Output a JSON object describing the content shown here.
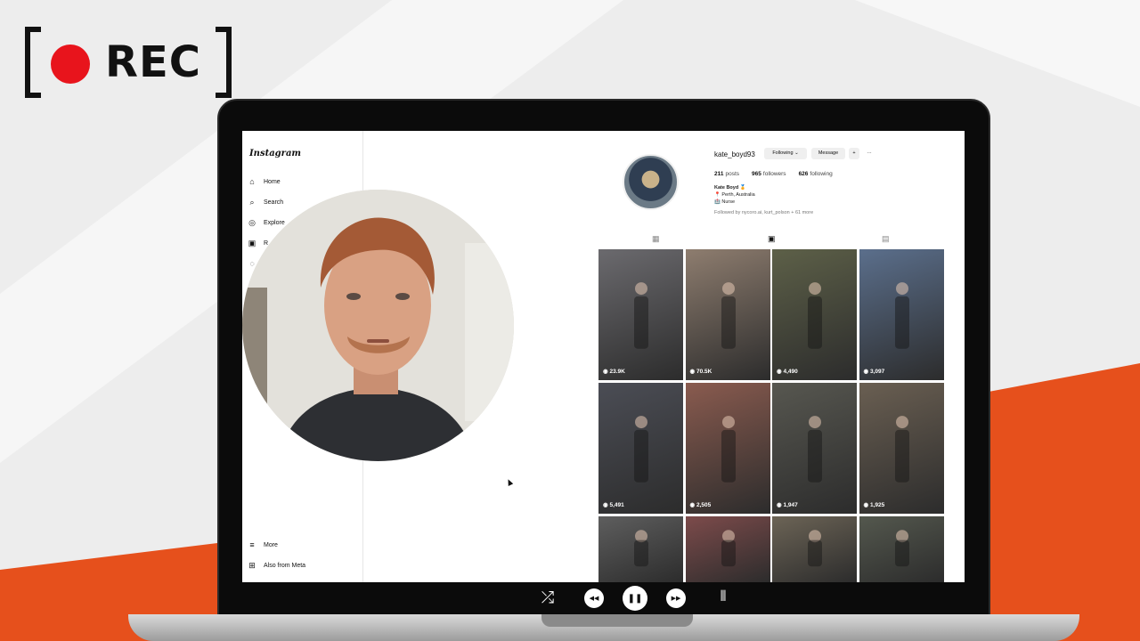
{
  "rec": {
    "label": "REC"
  },
  "sidebar": {
    "logo": "Instagram",
    "items": [
      {
        "label": "Home",
        "icon": "home-icon"
      },
      {
        "label": "Search",
        "icon": "search-icon"
      },
      {
        "label": "Explore",
        "icon": "compass-icon"
      },
      {
        "label": "R",
        "icon": "reels-icon"
      },
      {
        "label": "",
        "icon": "messages-icon"
      }
    ],
    "bottom": [
      {
        "label": "More",
        "icon": "menu-icon"
      },
      {
        "label": "Also from Meta",
        "icon": "meta-icon"
      }
    ]
  },
  "profile": {
    "username": "kate_boyd93",
    "following_button": "Following ⌄",
    "message_button": "Message",
    "add_user": "+",
    "more": "···",
    "posts": "211",
    "posts_label": "posts",
    "followers": "965",
    "followers_label": "followers",
    "following": "626",
    "following_label": "following",
    "name": "Kate Boyd 🏅",
    "location": "📍 Perth, Australia",
    "occupation": "🏥 Nurse",
    "followed_by": "Followed by nycoro.ai, kurt_polson + 61 more"
  },
  "tabs": [
    {
      "icon": "grid-icon",
      "glyph": "▦"
    },
    {
      "icon": "reels-tab-icon",
      "glyph": "▣"
    },
    {
      "icon": "tagged-icon",
      "glyph": "▤"
    }
  ],
  "posts": [
    {
      "views": "23.9K",
      "color": "#6b6a6e"
    },
    {
      "views": "70.5K",
      "color": "#8e7d6f"
    },
    {
      "views": "4,490",
      "color": "#5d6048"
    },
    {
      "views": "3,097",
      "color": "#5b6f8c"
    },
    {
      "views": "5,491",
      "color": "#4b4d55"
    },
    {
      "views": "2,505",
      "color": "#8a5b4f"
    },
    {
      "views": "1,947",
      "color": "#575750"
    },
    {
      "views": "1,925",
      "color": "#6a5f52"
    },
    {
      "views": "",
      "color": "#5e5e5e"
    },
    {
      "views": "",
      "color": "#7d4b4b"
    },
    {
      "views": "",
      "color": "#6c6456"
    },
    {
      "views": "",
      "color": "#54584e"
    }
  ],
  "player": {
    "shuffle": "⤮",
    "rewind": "◀◀",
    "pause": "❚❚",
    "forward": "▶▶",
    "waveform": "⦀"
  },
  "colors": {
    "accent": "#e8501a",
    "rec_red": "#e8141c"
  }
}
